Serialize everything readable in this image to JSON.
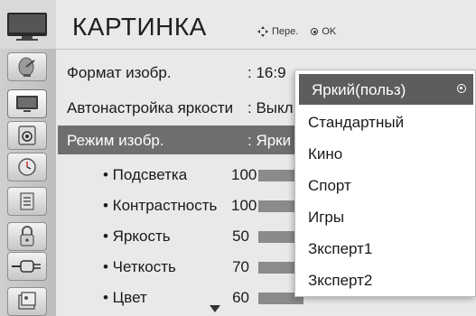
{
  "header": {
    "title": "КАРТИНКА",
    "nav_label": "Пере.",
    "ok_label": "OK"
  },
  "sidebar": {
    "icons": [
      "tv-icon",
      "satellite-dish-icon",
      "picture-icon",
      "speaker-icon",
      "clock-icon",
      "options-icon",
      "lock-icon",
      "input-icon",
      "media-icon"
    ]
  },
  "menu": {
    "rows": [
      {
        "label": "Формат изобр.",
        "value": ": 16:9"
      },
      {
        "label": "Автонастройка яркости",
        "value": ": Выкл"
      },
      {
        "label": "Режим изобр.",
        "value": ": Ярки"
      }
    ],
    "sub_rows": [
      {
        "label": "• Подсветка",
        "value": "100",
        "level": 1.0
      },
      {
        "label": "• Контрастность",
        "value": "100",
        "level": 1.0
      },
      {
        "label": "• Яркость",
        "value": "50",
        "level": 0.5
      },
      {
        "label": "• Четкость",
        "value": "70",
        "level": 0.7
      },
      {
        "label": "• Цвет",
        "value": "60",
        "level": 0.6
      }
    ]
  },
  "popup": {
    "selected": "Яркий(польз)",
    "options": [
      "Стандартный",
      "Кино",
      "Спорт",
      "Игры",
      "Зксперт1",
      "Зксперт2"
    ]
  }
}
